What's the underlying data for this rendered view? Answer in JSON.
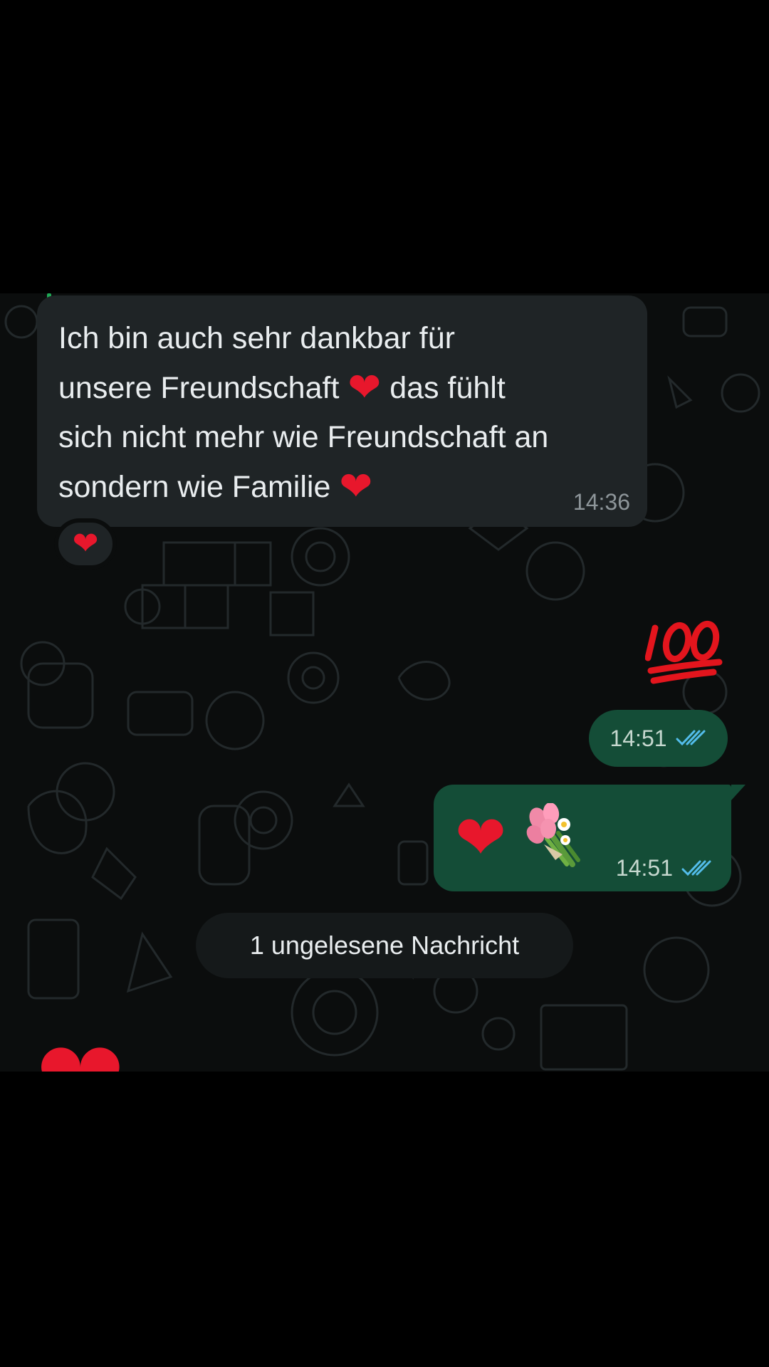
{
  "incoming_message": {
    "lines": [
      {
        "before": "Ich bin auch sehr dankbar für",
        "emoji": "",
        "after": ""
      },
      {
        "before": "unsere Freundschaft",
        "emoji": "❤",
        "after": "das fühlt"
      },
      {
        "before": "sich nicht mehr wie Freundschaft an",
        "emoji": "",
        "after": ""
      },
      {
        "before": "sondern wie Familie",
        "emoji": "❤",
        "after": ""
      }
    ],
    "time": "14:36",
    "reaction": "❤"
  },
  "outgoing_messages": [
    {
      "content": "💯",
      "time": "14:51",
      "status": "read"
    },
    {
      "content": "❤💐",
      "time": "14:51",
      "status": "read"
    }
  ],
  "unread_divider": "1 ungelesene Nachricht",
  "last_incoming": {
    "content": "❤"
  },
  "colors": {
    "incoming_bubble": "#1f2426",
    "outgoing_bubble": "#144d37",
    "read_ticks": "#53bdeb",
    "heart": "#e8172c"
  },
  "icons": {
    "read_receipt": "double-check-icon",
    "hundred": "hundred-points-emoji",
    "bouquet": "bouquet-emoji"
  }
}
